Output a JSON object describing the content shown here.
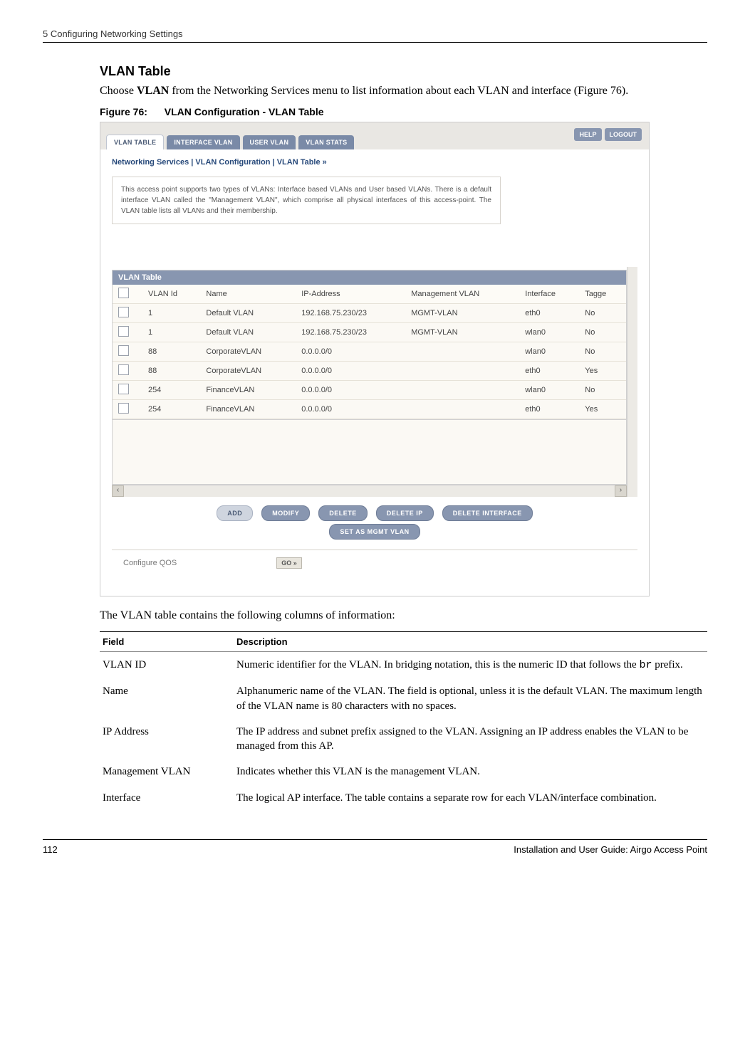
{
  "header": {
    "chapter": "5  Configuring Networking Settings"
  },
  "section": {
    "heading": "VLAN Table",
    "intro_pre": "Choose ",
    "intro_bold": "VLAN",
    "intro_post": " from the Networking Services menu to list information about each VLAN and interface (Figure 76).",
    "fig_label": "Figure 76:",
    "fig_title": "VLAN Configuration - VLAN Table",
    "after_fig": "The VLAN table contains the following columns of information:"
  },
  "screenshot": {
    "tabs": [
      "VLAN TABLE",
      "INTERFACE VLAN",
      "USER VLAN",
      "VLAN STATS"
    ],
    "top_buttons": {
      "help": "HELP",
      "logout": "LOGOUT"
    },
    "breadcrumb": "Networking Services | VLAN Configuration | VLAN Table   »",
    "explain": "This access point supports two types of VLANs: Interface based VLANs and User based VLANs. There is a default interface VLAN called the \"Management VLAN\", which comprise all physical interfaces of this access-point. The VLAN table lists all VLANs and their membership.",
    "table_title": "VLAN Table",
    "columns": [
      "",
      "VLAN Id",
      "Name",
      "IP-Address",
      "Management VLAN",
      "Interface",
      "Tagge"
    ],
    "rows": [
      {
        "vlan_id": "1",
        "name": "Default VLAN",
        "ip": "192.168.75.230/23",
        "mgmt": "MGMT-VLAN",
        "iface": "eth0",
        "tag": "No"
      },
      {
        "vlan_id": "1",
        "name": "Default VLAN",
        "ip": "192.168.75.230/23",
        "mgmt": "MGMT-VLAN",
        "iface": "wlan0",
        "tag": "No"
      },
      {
        "vlan_id": "88",
        "name": "CorporateVLAN",
        "ip": "0.0.0.0/0",
        "mgmt": "",
        "iface": "wlan0",
        "tag": "No"
      },
      {
        "vlan_id": "88",
        "name": "CorporateVLAN",
        "ip": "0.0.0.0/0",
        "mgmt": "",
        "iface": "eth0",
        "tag": "Yes"
      },
      {
        "vlan_id": "254",
        "name": "FinanceVLAN",
        "ip": "0.0.0.0/0",
        "mgmt": "",
        "iface": "wlan0",
        "tag": "No"
      },
      {
        "vlan_id": "254",
        "name": "FinanceVLAN",
        "ip": "0.0.0.0/0",
        "mgmt": "",
        "iface": "eth0",
        "tag": "Yes"
      }
    ],
    "buttons": {
      "add": "ADD",
      "modify": "MODIFY",
      "delete": "DELETE",
      "delete_ip": "DELETE IP",
      "delete_interface": "DELETE INTERFACE",
      "set_mgmt": "SET AS MGMT VLAN"
    },
    "qos_label": "Configure QOS",
    "go_label": "GO »"
  },
  "field_table": {
    "headers": {
      "field": "Field",
      "desc": "Description"
    },
    "rows": [
      {
        "field": "VLAN ID",
        "desc_pre": "Numeric identifier for the VLAN. In bridging notation, this is the numeric ID that follows the ",
        "desc_code": "br",
        "desc_post": " prefix."
      },
      {
        "field": "Name",
        "desc": "Alphanumeric name of the VLAN. The field is optional, unless it is the default VLAN. The maximum length of the VLAN name is 80 characters with no spaces."
      },
      {
        "field": "IP Address",
        "desc": "The IP address and subnet prefix assigned to the VLAN. Assigning an IP address enables the VLAN to be managed from this AP."
      },
      {
        "field": "Management VLAN",
        "desc": "Indicates whether this VLAN is the management VLAN."
      },
      {
        "field": "Interface",
        "desc": "The logical AP interface. The table contains a separate row for each VLAN/interface combination."
      }
    ]
  },
  "footer": {
    "page": "112",
    "doc": "Installation and User Guide: Airgo Access Point"
  }
}
